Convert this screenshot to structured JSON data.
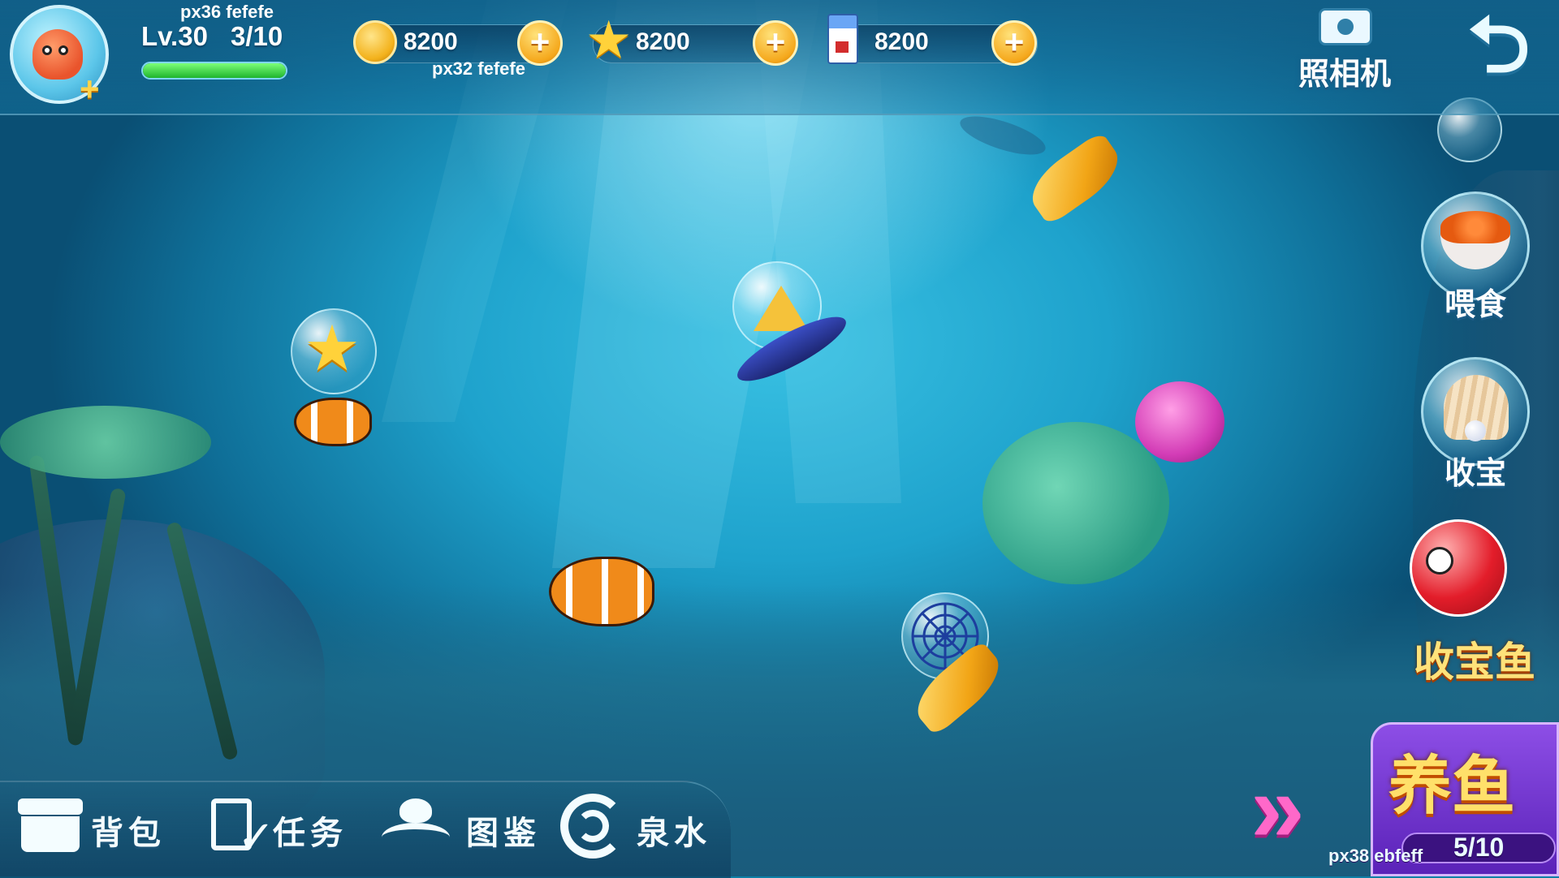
{
  "player": {
    "name_tag": "px36 fefefe",
    "level": "Lv.30",
    "progress": "3/10",
    "xp_fraction": 1.0
  },
  "resources": {
    "coins": "8200",
    "stars": "8200",
    "milk": "8200",
    "plus": "+",
    "note": "px32 fefefe"
  },
  "top_actions": {
    "camera_label": "照相机",
    "back_symbol": "⮌"
  },
  "side_buttons": {
    "feed": "喂食",
    "collect": "收宝",
    "treasure_fish": "收宝鱼"
  },
  "breeding": {
    "title": "养鱼",
    "arrows": "»",
    "progress": "5/10",
    "note": "px38 ebfeff"
  },
  "toolbar": {
    "bag": "背包",
    "tasks": "任务",
    "codex": "图鉴",
    "spring": "泉水"
  },
  "icons": [
    "avatar-octopus",
    "coin-icon",
    "star-icon",
    "milk-icon",
    "camera-icon",
    "back-arrow-icon",
    "fish-food-icon",
    "shell-pearl-icon",
    "treasure-fish-icon",
    "bag-icon",
    "task-icon",
    "codex-icon",
    "spiral-icon"
  ],
  "colors": {
    "accent_gold": "#f5a81c",
    "xp_green": "#1fb52d",
    "breed_purple": "#5a22b8",
    "label_yellow": "#ffe06a"
  }
}
